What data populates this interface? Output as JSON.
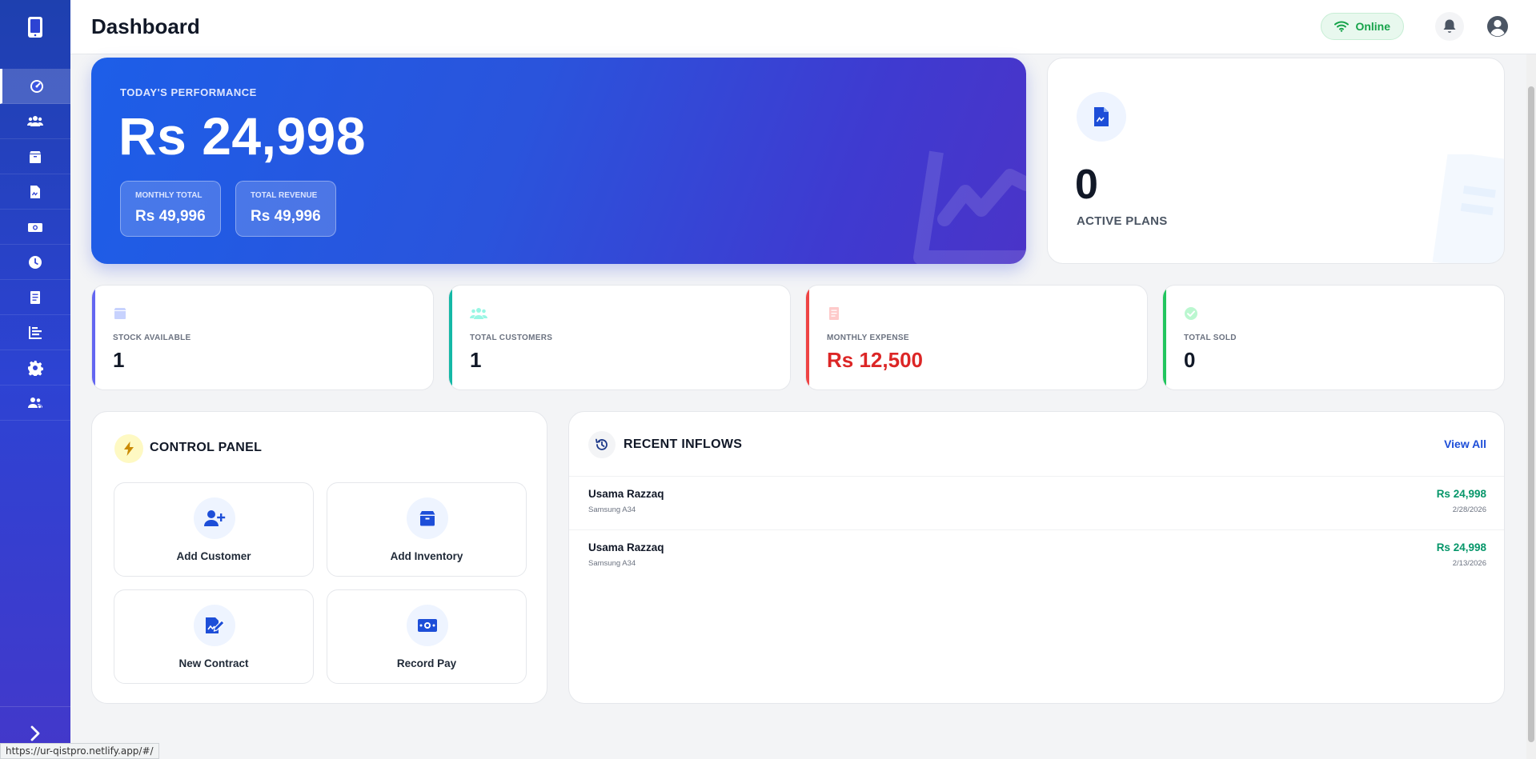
{
  "header": {
    "title": "Dashboard",
    "status": "Online"
  },
  "sidebar": {
    "items": [
      {
        "icon": "dashboard-icon",
        "active": true
      },
      {
        "icon": "customers-icon"
      },
      {
        "icon": "inventory-box-icon"
      },
      {
        "icon": "contract-document-icon"
      },
      {
        "icon": "payments-cash-icon"
      },
      {
        "icon": "history-clock-icon"
      },
      {
        "icon": "ledger-report-icon"
      },
      {
        "icon": "analytics-chart-icon"
      },
      {
        "icon": "settings-gear-icon"
      },
      {
        "icon": "users-group-icon"
      }
    ]
  },
  "hero": {
    "label": "TODAY'S PERFORMANCE",
    "value": "Rs 24,998",
    "monthly_total_label": "MONTHLY TOTAL",
    "monthly_total_value": "Rs 49,996",
    "total_revenue_label": "TOTAL REVENUE",
    "total_revenue_value": "Rs 49,996"
  },
  "plans": {
    "value": "0",
    "label": "ACTIVE PLANS"
  },
  "stats": [
    {
      "label": "STOCK AVAILABLE",
      "value": "1",
      "color": "#6366f1"
    },
    {
      "label": "TOTAL CUSTOMERS",
      "value": "1",
      "color": "#14b8a6"
    },
    {
      "label": "MONTHLY EXPENSE",
      "value": "Rs 12,500",
      "color": "#ef4444"
    },
    {
      "label": "TOTAL SOLD",
      "value": "0",
      "color": "#22c55e"
    }
  ],
  "control_panel": {
    "title": "CONTROL PANEL",
    "actions": [
      {
        "label": "Add Customer",
        "icon": "user-plus-icon"
      },
      {
        "label": "Add Inventory",
        "icon": "box-icon"
      },
      {
        "label": "New Contract",
        "icon": "contract-edit-icon"
      },
      {
        "label": "Record Pay",
        "icon": "money-icon"
      }
    ]
  },
  "inflows": {
    "title": "RECENT INFLOWS",
    "view_all": "View All",
    "rows": [
      {
        "name": "Usama Razzaq",
        "item": "Samsung A34",
        "amount": "Rs 24,998",
        "date": "2/28/2026"
      },
      {
        "name": "Usama Razzaq",
        "item": "Samsung A34",
        "amount": "Rs 24,998",
        "date": "2/13/2026"
      }
    ]
  },
  "status_url": "https://ur-qistpro.netlify.app/#/",
  "colors": {
    "primary": "#1d4ed8",
    "expense_red": "#dc2626",
    "success_green": "#059669",
    "online_green": "#16a34a"
  }
}
